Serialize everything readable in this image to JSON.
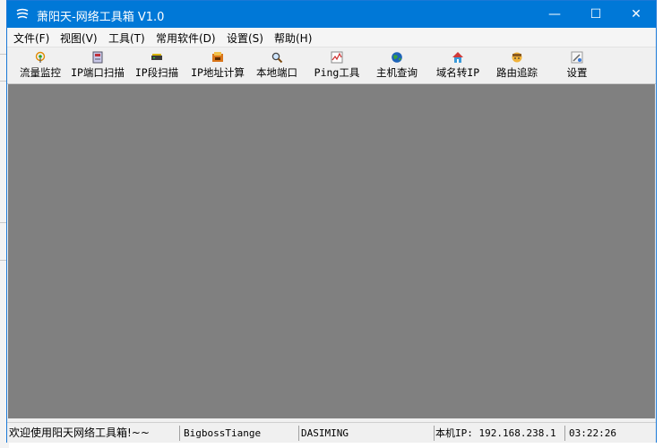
{
  "window": {
    "title": "萧阳天-网络工具箱 V1.0",
    "controls": {
      "minimize": "—",
      "maximize": "☐",
      "close": "✕"
    }
  },
  "menu": [
    {
      "label": "文件(F)"
    },
    {
      "label": "视图(V)"
    },
    {
      "label": "工具(T)"
    },
    {
      "label": "常用软件(D)"
    },
    {
      "label": "设置(S)"
    },
    {
      "label": "帮助(H)"
    }
  ],
  "toolbar": [
    {
      "label": "流量监控",
      "icon": "antenna-icon"
    },
    {
      "label": "IP端口扫描",
      "icon": "scanner-icon"
    },
    {
      "label": "IP段扫描",
      "icon": "network-device-icon"
    },
    {
      "label": "IP地址计算",
      "icon": "calculator-icon"
    },
    {
      "label": "本地端口",
      "icon": "magnifier-icon"
    },
    {
      "label": "Ping工具",
      "icon": "ping-chart-icon"
    },
    {
      "label": "主机查询",
      "icon": "globe-icon"
    },
    {
      "label": "域名转IP",
      "icon": "home-icon"
    },
    {
      "label": "路由追踪",
      "icon": "route-face-icon"
    },
    {
      "label": "设置",
      "icon": "settings-icon"
    }
  ],
  "status": {
    "welcome": "欢迎使用阳天网络工具箱!~~",
    "user": "BigbossTiange",
    "computer": "DASIMING",
    "local_ip": "本机IP: 192.168.238.1",
    "time": "03:22:26"
  },
  "colors": {
    "titlebar": "#0078d7",
    "mdi_background": "#808080"
  }
}
